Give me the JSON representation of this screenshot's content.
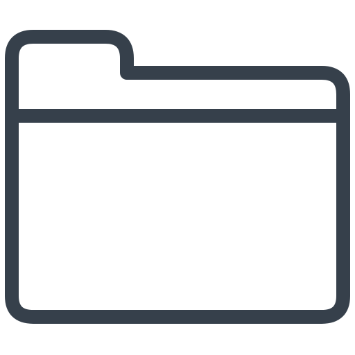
{
  "icon": {
    "name": "folder-icon",
    "stroke_color": "#36404b",
    "background_color": "#ffffff"
  }
}
